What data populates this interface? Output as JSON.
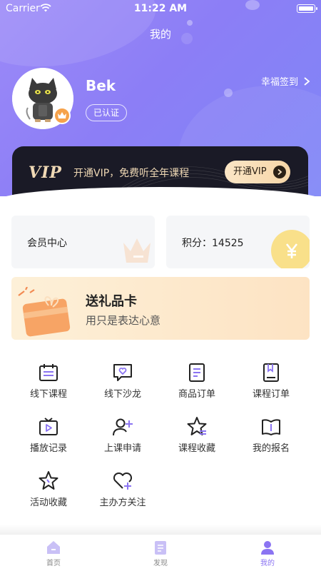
{
  "status_bar": {
    "carrier": "Carrier",
    "time": "11:22 AM"
  },
  "nav": {
    "title": "我的"
  },
  "profile": {
    "name": "Bek",
    "cert_label": "已认证",
    "checkin_label": "幸福签到"
  },
  "vip": {
    "logo": "VIP",
    "text": "开通VIP，免费听全年课程",
    "button_label": "开通VIP"
  },
  "cards": {
    "member_label": "会员中心",
    "points_label": "积分：",
    "points_value": "14525"
  },
  "gift": {
    "title": "送礼品卡",
    "subtitle": "用只是表达心意"
  },
  "grid": [
    {
      "label": "线下课程",
      "icon": "calendar-icon"
    },
    {
      "label": "线下沙龙",
      "icon": "chat-heart-icon"
    },
    {
      "label": "商品订单",
      "icon": "document-icon"
    },
    {
      "label": "课程订单",
      "icon": "bookmark-book-icon"
    },
    {
      "label": "播放记录",
      "icon": "tv-play-icon"
    },
    {
      "label": "上课申请",
      "icon": "user-add-icon"
    },
    {
      "label": "课程收藏",
      "icon": "star-list-icon"
    },
    {
      "label": "我的报名",
      "icon": "open-book-icon"
    },
    {
      "label": "活动收藏",
      "icon": "star-icon"
    },
    {
      "label": "主办方关注",
      "icon": "heart-add-icon"
    }
  ],
  "tabbar": [
    {
      "label": "首页",
      "icon": "home-icon",
      "active": false
    },
    {
      "label": "发现",
      "icon": "discover-icon",
      "active": false
    },
    {
      "label": "我的",
      "icon": "profile-icon",
      "active": true
    }
  ],
  "colors": {
    "accent": "#8b74f2",
    "header_gradient_start": "#9c8af8",
    "header_gradient_end": "#7f86f7",
    "vip_gold": "#f0d9b5",
    "coin": "#f9e08a"
  }
}
